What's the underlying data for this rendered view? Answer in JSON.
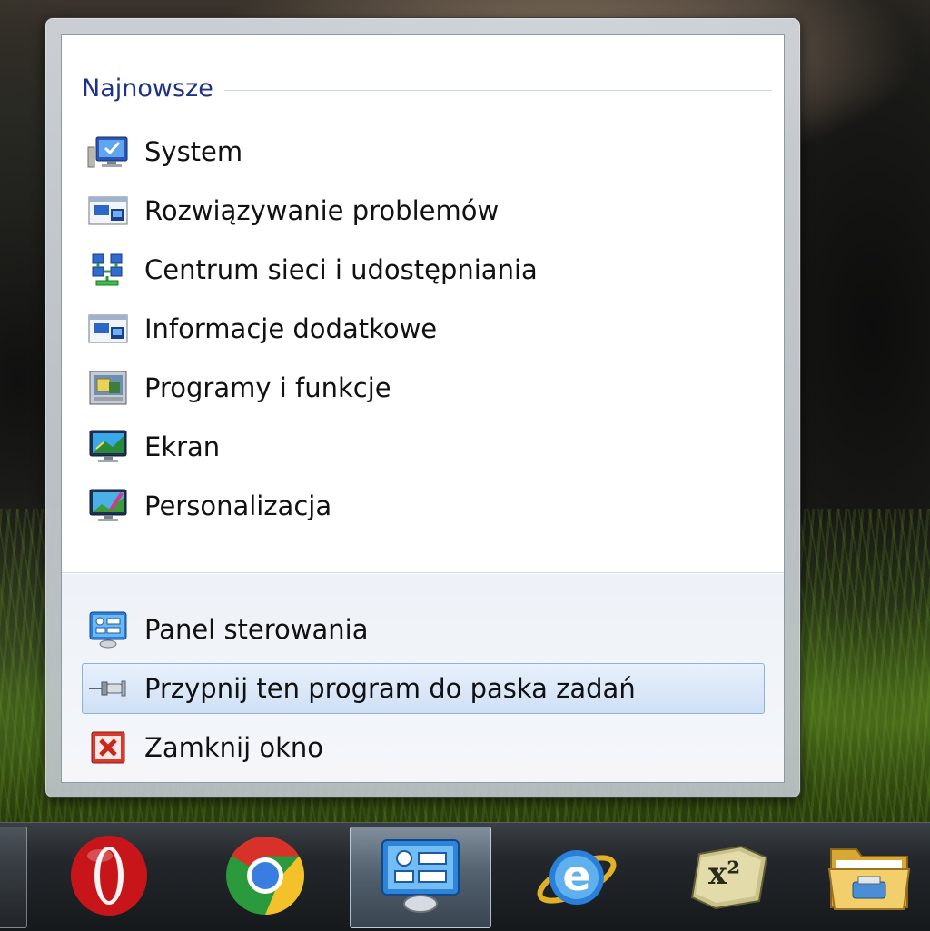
{
  "jumplist": {
    "recent_header": "Najnowsze",
    "recent_items": [
      {
        "label": "System",
        "icon": "system-icon"
      },
      {
        "label": "Rozwiązywanie problemów",
        "icon": "troubleshooting-icon"
      },
      {
        "label": "Centrum sieci i udostępniania",
        "icon": "network-center-icon"
      },
      {
        "label": "Informacje dodatkowe",
        "icon": "additional-info-icon"
      },
      {
        "label": "Programy i funkcje",
        "icon": "programs-features-icon"
      },
      {
        "label": "Ekran",
        "icon": "display-icon"
      },
      {
        "label": "Personalizacja",
        "icon": "personalization-icon"
      }
    ],
    "tasks": [
      {
        "label": "Panel sterowania",
        "icon": "control-panel-icon"
      },
      {
        "label": "Przypnij ten program do paska zadań",
        "icon": "pin-icon",
        "highlighted": true
      },
      {
        "label": "Zamknij okno",
        "icon": "close-window-icon"
      }
    ]
  },
  "taskbar": {
    "buttons": [
      {
        "app": "opera",
        "icon": "opera-icon",
        "active": false
      },
      {
        "app": "chrome",
        "icon": "chrome-icon",
        "active": false
      },
      {
        "app": "control-panel",
        "icon": "control-panel-icon",
        "active": true
      },
      {
        "app": "internet-explorer",
        "icon": "internet-explorer-icon",
        "active": false
      },
      {
        "app": "calculator-x2",
        "icon": "calculator-x2-icon",
        "active": false
      },
      {
        "app": "explorer",
        "icon": "folder-icon",
        "active": false
      }
    ],
    "calc_glyph": "x²"
  },
  "colors": {
    "header_text": "#1e3287",
    "highlight_border": "#8fb2d9",
    "taskbar": "#23272b"
  }
}
